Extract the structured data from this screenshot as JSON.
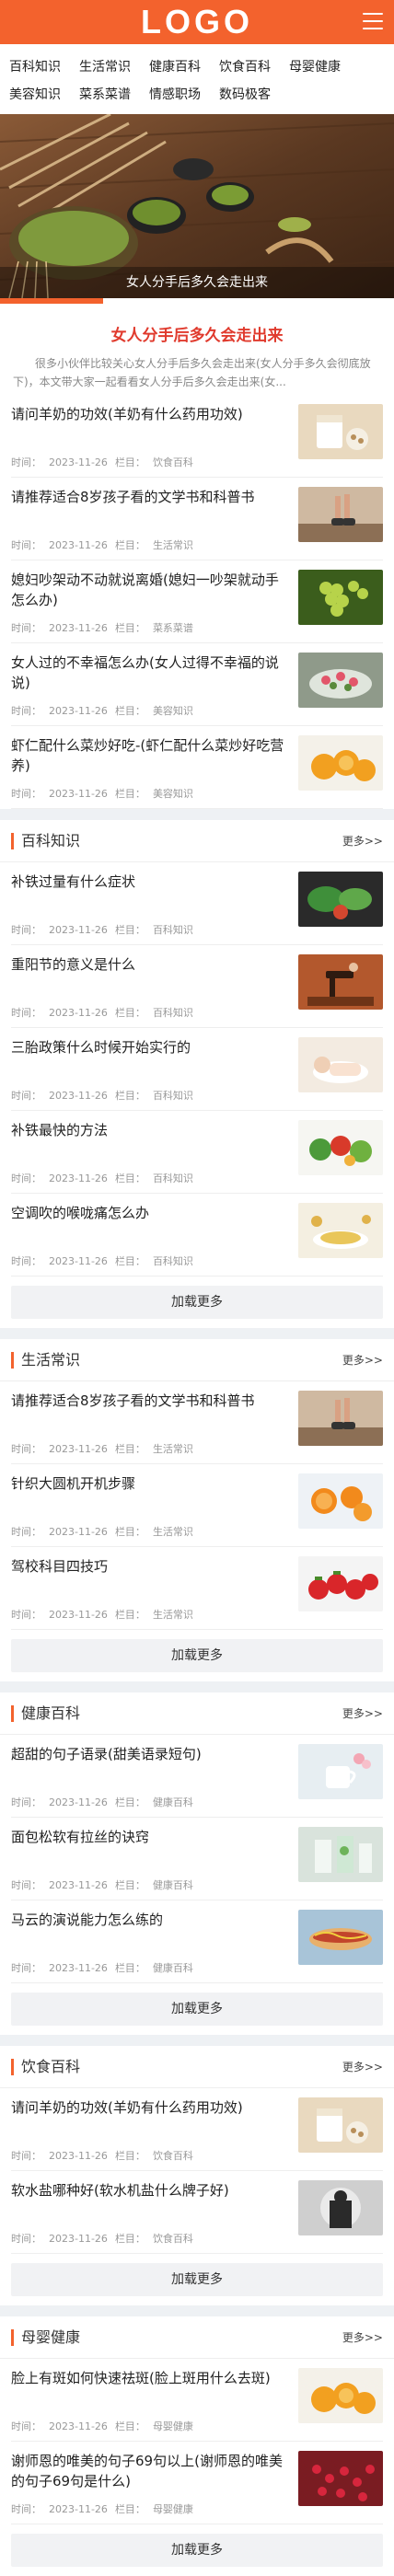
{
  "header": {
    "logo": "LOGO"
  },
  "nav": [
    "百科知识",
    "生活常识",
    "健康百科",
    "饮食百科",
    "母婴健康",
    "美容知识",
    "菜系菜谱",
    "情感职场",
    "数码极客"
  ],
  "banner": {
    "caption": "女人分手后多久会走出来"
  },
  "featured": {
    "title": "女人分手后多久会走出来",
    "desc": "很多小伙伴比较关心女人分手后多久会走出来(女人分手多久会彻底放下)，本文带大家一起看看女人分手后多久会走出来(女..."
  },
  "meta": {
    "time_prefix": "时间：",
    "col_prefix": "栏目："
  },
  "top_list": [
    {
      "title": "请问羊奶的功效(羊奶有什么药用功效)",
      "date": "2023-11-26",
      "column": "饮食百科",
      "thumb": "milk"
    },
    {
      "title": "请推荐适合8岁孩子看的文学书和科普书",
      "date": "2023-11-26",
      "column": "生活常识",
      "thumb": "runner"
    },
    {
      "title": "媳妇吵架动不动就说离婚(媳妇一吵架就动手 怎么办)",
      "date": "2023-11-26",
      "column": "菜系菜谱",
      "thumb": "grapes"
    },
    {
      "title": "女人过的不幸福怎么办(女人过得不幸福的说说)",
      "date": "2023-11-26",
      "column": "美容知识",
      "thumb": "flowers"
    },
    {
      "title": "虾仁配什么菜炒好吃-(虾仁配什么菜炒好吃营养)",
      "date": "2023-11-26",
      "column": "美容知识",
      "thumb": "oranges"
    }
  ],
  "more_label": "更多>>",
  "load_more_label": "加载更多",
  "sections": [
    {
      "title": "百科知识",
      "items": [
        {
          "title": "补铁过量有什么症状",
          "date": "2023-11-26",
          "column": "百科知识",
          "thumb": "vegetables"
        },
        {
          "title": "重阳节的意义是什么",
          "date": "2023-11-26",
          "column": "百科知识",
          "thumb": "gym"
        },
        {
          "title": "三胎政策什么时候开始实行的",
          "date": "2023-11-26",
          "column": "百科知识",
          "thumb": "baby"
        },
        {
          "title": "补铁最快的方法",
          "date": "2023-11-26",
          "column": "百科知识",
          "thumb": "veg2"
        },
        {
          "title": "空调吹的喉咙痛怎么办",
          "date": "2023-11-26",
          "column": "百科知识",
          "thumb": "oil"
        }
      ]
    },
    {
      "title": "生活常识",
      "items": [
        {
          "title": "请推荐适合8岁孩子看的文学书和科普书",
          "date": "2023-11-26",
          "column": "生活常识",
          "thumb": "runner"
        },
        {
          "title": "针织大圆机开机步骤",
          "date": "2023-11-26",
          "column": "生活常识",
          "thumb": "citrus"
        },
        {
          "title": "驾校科目四技巧",
          "date": "2023-11-26",
          "column": "生活常识",
          "thumb": "strawberry"
        }
      ]
    },
    {
      "title": "健康百科",
      "items": [
        {
          "title": "超甜的句子语录(甜美语录短句)",
          "date": "2023-11-26",
          "column": "健康百科",
          "thumb": "cup"
        },
        {
          "title": "面包松软有拉丝的诀窍",
          "date": "2023-11-26",
          "column": "健康百科",
          "thumb": "drinks"
        },
        {
          "title": "马云的演说能力怎么练的",
          "date": "2023-11-26",
          "column": "健康百科",
          "thumb": "hotdog"
        }
      ]
    },
    {
      "title": "饮食百科",
      "items": [
        {
          "title": "请问羊奶的功效(羊奶有什么药用功效)",
          "date": "2023-11-26",
          "column": "饮食百科",
          "thumb": "milk"
        },
        {
          "title": "软水盐哪种好(软水机盐什么牌子好)",
          "date": "2023-11-26",
          "column": "饮食百科",
          "thumb": "silhouette"
        }
      ]
    },
    {
      "title": "母婴健康",
      "items": [
        {
          "title": "脸上有斑如何快速祛斑(脸上斑用什么去斑)",
          "date": "2023-11-26",
          "column": "母婴健康",
          "thumb": "oranges"
        },
        {
          "title": "谢师恩的唯美的句子69句以上(谢师恩的唯美的句子69句是什么)",
          "date": "2023-11-26",
          "column": "母婴健康",
          "thumb": "pomegranate"
        }
      ]
    }
  ]
}
